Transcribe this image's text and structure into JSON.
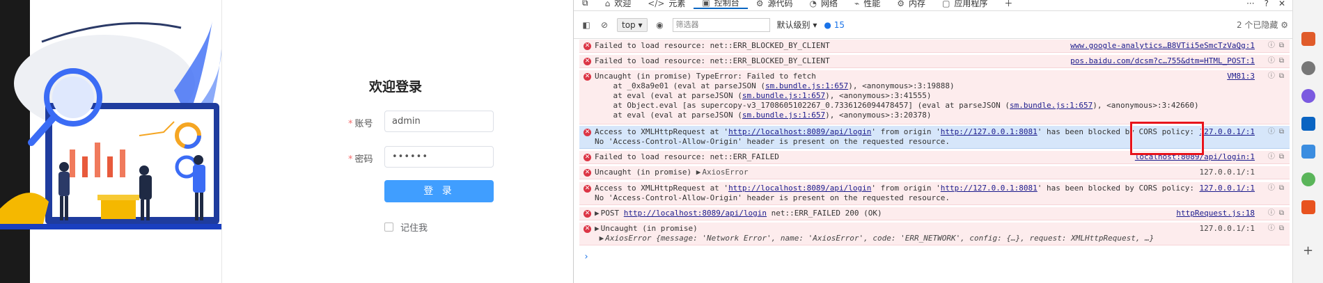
{
  "login": {
    "title": "欢迎登录",
    "username_label": "账号",
    "username_value": "admin",
    "password_label": "密码",
    "password_value": "••••••",
    "submit": "登 录",
    "remember": "记住我"
  },
  "devtools": {
    "tabs": [
      "欢迎",
      "元素",
      "控制台",
      "源代码",
      "网络",
      "性能",
      "内存",
      "应用程序"
    ],
    "active_tab": "控制台",
    "context": "top",
    "filter_placeholder": "筛选器",
    "level": "默认级别",
    "issues_count": "15",
    "hidden": "2 个已隐藏"
  },
  "console": {
    "messages": [
      {
        "text": "Failed to load resource: net::ERR_BLOCKED_BY_CLIENT",
        "source": "www.google-analytics…B8VTii5eSmcTzVaQg:1"
      },
      {
        "text": "Failed to load resource: net::ERR_BLOCKED_BY_CLIENT",
        "source": "pos.baidu.com/dcsm?c…755&dtm=HTML_POST:1"
      },
      {
        "text": "Uncaught (in promise) TypeError: Failed to fetch",
        "source": "VM81:3",
        "stack": [
          {
            "pre": "    at _0x8a9e01 (eval at parseJSON (",
            "link": "sm.bundle.js:1:657",
            "post": "), <anonymous>:3:19888)"
          },
          {
            "pre": "    at eval (eval at parseJSON (",
            "link": "sm.bundle.js:1:657",
            "post": "), <anonymous>:3:41555)"
          },
          {
            "pre": "    at Object.eval [as supercopy-v3_1708605102267_0.7336126094478457] (eval at parseJSON (",
            "link": "sm.bundle.js:1:657",
            "post": "), <anonymous>:3:42660)"
          },
          {
            "pre": "    at eval (eval at parseJSON (",
            "link": "sm.bundle.js:1:657",
            "post": "), <anonymous>:3:20378)"
          }
        ]
      },
      {
        "pre": "Access to XMLHttpRequest at '",
        "url1": "http://localhost:8089/api/login",
        "mid": "' from origin '",
        "url2": "http://127.0.0.1:8081",
        "post": "' has been blocked by CORS policy:",
        "line2": "No 'Access-Control-Allow-Origin' header is present on the requested resource.",
        "source": "127.0.0.1/:1"
      },
      {
        "text": "Failed to load resource: net::ERR_FAILED",
        "source": "localhost:8089/api/login:1"
      },
      {
        "text": "Uncaught (in promise)",
        "detail": "AxiosError",
        "source": "127.0.0.1/:1"
      },
      {
        "pre": "Access to XMLHttpRequest at '",
        "url1": "http://localhost:8089/api/login",
        "mid": "' from origin '",
        "url2": "http://127.0.0.1:8081",
        "post": "' has been blocked by CORS policy:",
        "line2": "No 'Access-Control-Allow-Origin' header is present on the requested resource.",
        "source": "127.0.0.1/:1"
      },
      {
        "pre": "POST ",
        "url": "http://localhost:8089/api/login",
        "post": " net::ERR_FAILED 200 (OK)",
        "source": "httpRequest.js:18"
      },
      {
        "text": "Uncaught (in promise)",
        "detail": "AxiosError {message: 'Network Error', name: 'AxiosError', code: 'ERR_NETWORK', config: {…}, request: XMLHttpRequest, …}",
        "source": "127.0.0.1/:1"
      }
    ]
  },
  "colors": {
    "accent": "#409eff",
    "error_bg": "#fdeced",
    "selected_bg": "#d6e6fa",
    "highlight": "#e8141c"
  }
}
